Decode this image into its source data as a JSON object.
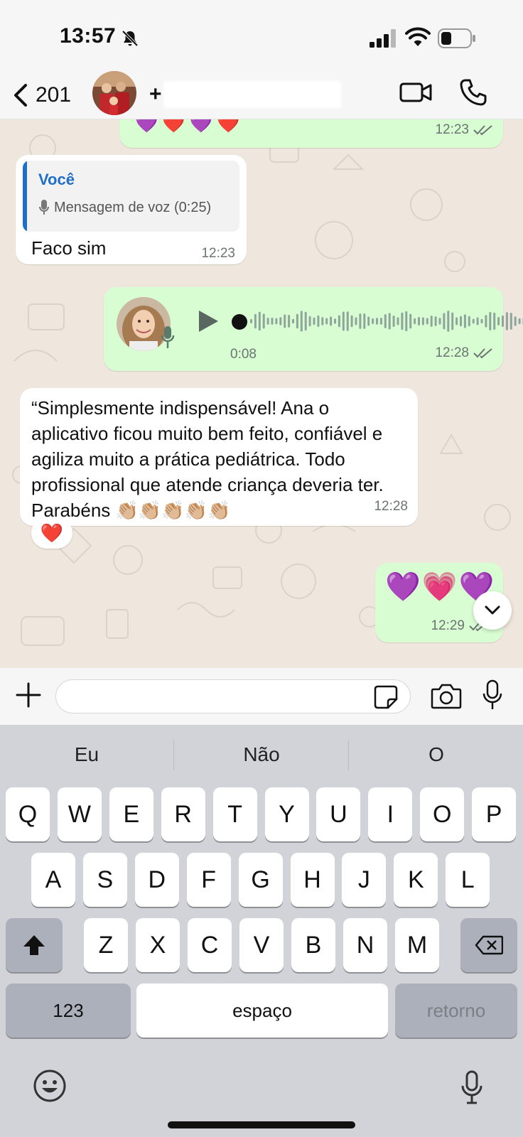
{
  "status_bar": {
    "time": "13:57",
    "icons": [
      "bell-slash-icon",
      "signal-icon",
      "wifi-icon",
      "battery-icon"
    ]
  },
  "header": {
    "back_count": "201",
    "contact_prefix": "+",
    "icons": [
      "chevron-left-icon",
      "video-camera-icon",
      "phone-icon"
    ]
  },
  "chat": {
    "messages": [
      {
        "direction": "out",
        "text": "💜❤️💜❤️",
        "time": "12:23",
        "status": "read"
      },
      {
        "direction": "in",
        "reply_to": {
          "author": "Você",
          "preview": "Mensagem de voz (0:25)"
        },
        "text": "Faco sim",
        "time": "12:23"
      },
      {
        "direction": "out",
        "type": "voice",
        "duration": "0:08",
        "time": "12:28",
        "status": "read"
      },
      {
        "direction": "in",
        "text": "“Simplesmente indispensável! Ana o aplicativo ficou muito bem feito, confiável e agiliza muito a prática pediátrica. Todo profissional que atende criança deveria ter. Parabéns 👏🏼👏🏼👏🏼👏🏼👏🏼",
        "time": "12:28",
        "reaction": "❤️"
      },
      {
        "direction": "out",
        "text": "💜💗💜",
        "time": "12:29",
        "status": "read"
      }
    ]
  },
  "composer": {
    "placeholder": "",
    "icons": [
      "plus-icon",
      "sticker-icon",
      "camera-icon",
      "microphone-icon"
    ]
  },
  "keyboard": {
    "suggestions": [
      "Eu",
      "Não",
      "O"
    ],
    "row1": [
      "Q",
      "W",
      "E",
      "R",
      "T",
      "Y",
      "U",
      "I",
      "O",
      "P"
    ],
    "row2": [
      "A",
      "S",
      "D",
      "F",
      "G",
      "H",
      "J",
      "K",
      "L"
    ],
    "row3": [
      "Z",
      "X",
      "C",
      "V",
      "B",
      "N",
      "M"
    ],
    "numbers_label": "123",
    "space_label": "espaço",
    "return_label": "retorno"
  },
  "colors": {
    "outgoing_bubble": "#d9fdd3",
    "incoming_bubble": "#ffffff",
    "chat_background": "#efe7dd",
    "quote_accent": "#1f6fc7",
    "keyboard_background": "#d1d3d9"
  }
}
